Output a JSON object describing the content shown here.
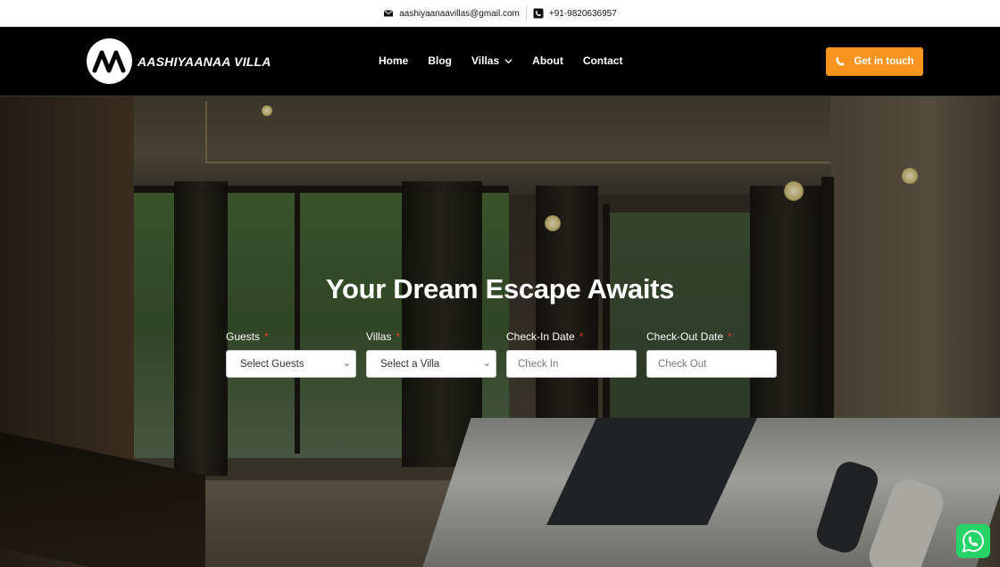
{
  "topbar": {
    "email": "aashiyaanaavillas@gmail.com",
    "phone": "+91-9820636957",
    "email_icon": "envelope-icon",
    "phone_icon": "phone-square-icon"
  },
  "header": {
    "brand_name": "AASHIYAANAA VILLA",
    "nav": [
      "Home",
      "Blog",
      "Villas",
      "About",
      "Contact"
    ],
    "cta_label": "Get in touch",
    "cta_color": "#f7931e"
  },
  "hero": {
    "title": "Your Dream Escape Awaits"
  },
  "booking_form": {
    "guests": {
      "label": "Guests",
      "required_mark": "*",
      "value": "Select Guests"
    },
    "villas": {
      "label": "Villas",
      "required_mark": "*",
      "value": "Select a Villa"
    },
    "check_in": {
      "label": "Check-In Date",
      "required_mark": "*",
      "placeholder": "Check In"
    },
    "check_out": {
      "label": "Check-Out Date",
      "required_mark": "*",
      "placeholder": "Check Out"
    }
  },
  "whatsapp": {
    "icon": "whatsapp-icon",
    "color": "#25d366"
  }
}
